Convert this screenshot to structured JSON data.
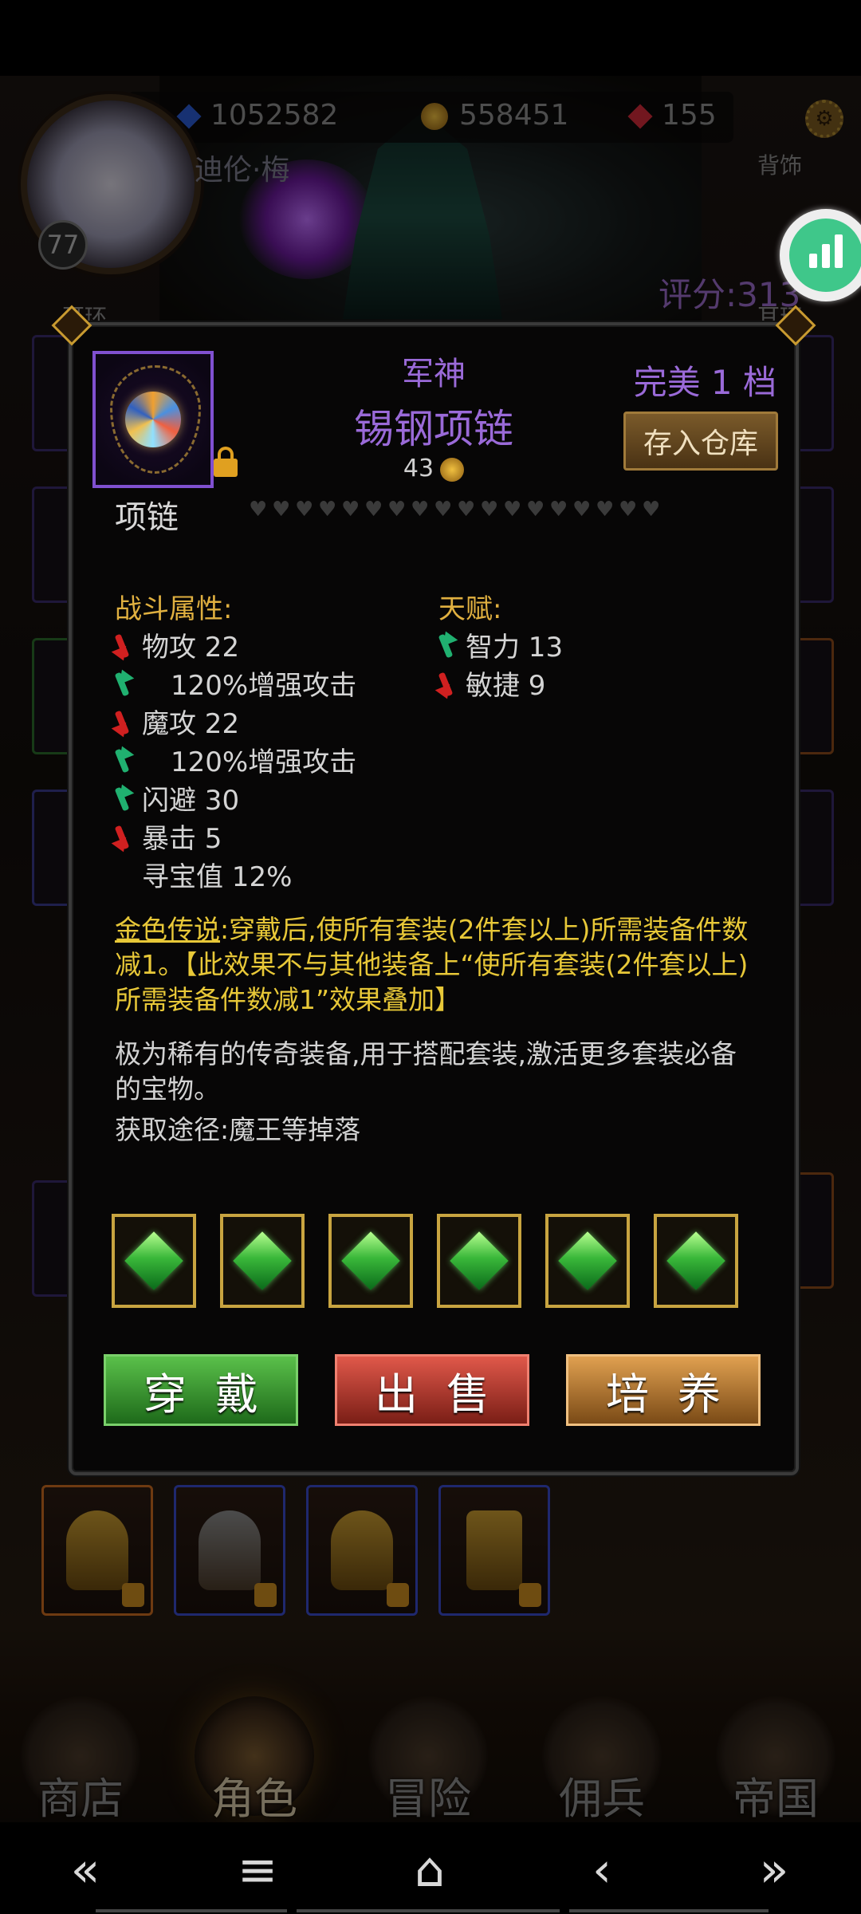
{
  "resources": {
    "gems": "1052582",
    "gold": "558451",
    "rubies": "155"
  },
  "player": {
    "name": "迪伦·梅",
    "level": "77"
  },
  "slot_labels": {
    "earring_left": "耳环",
    "back": "背饰",
    "earring_right": "耳环"
  },
  "score": "评分:313",
  "item": {
    "prefix": "军神",
    "name": "锡钢项链",
    "price": "43",
    "quality": "完美 1 档",
    "store_button": "存入仓库",
    "type": "项链",
    "durability_hearts": 18
  },
  "combat": {
    "title": "战斗属性:",
    "stats": [
      {
        "text": "物攻 22",
        "trend": "down"
      },
      {
        "text": "120%增强攻击",
        "trend": "up"
      },
      {
        "text": "魔攻 22",
        "trend": "down"
      },
      {
        "text": "120%增强攻击",
        "trend": "up"
      },
      {
        "text": "闪避 30",
        "trend": "up"
      },
      {
        "text": "暴击 5",
        "trend": "down"
      },
      {
        "text": "寻宝值 12%",
        "trend": "none"
      }
    ]
  },
  "talent": {
    "title": "天赋:",
    "stats": [
      {
        "text": "智力 13",
        "trend": "up"
      },
      {
        "text": "敏捷 9",
        "trend": "down"
      }
    ]
  },
  "legend": {
    "head": "金色传说",
    "body": ":穿戴后,使所有套装(2件套以上)所需装备件数减1。【此效果不与其他装备上“使所有套装(2件套以上)所需装备件数减1”效果叠加】"
  },
  "description": "极为稀有的传奇装备,用于搭配套装,激活更多套装必备的宝物。",
  "source": "获取途径:魔王等掉落",
  "socket_count": 6,
  "actions": {
    "wear": "穿戴",
    "sell": "出售",
    "train": "培养"
  },
  "bottom_nav": [
    {
      "label": "商店",
      "active": false
    },
    {
      "label": "角色",
      "active": true
    },
    {
      "label": "冒险",
      "active": false
    },
    {
      "label": "佣兵",
      "active": false
    },
    {
      "label": "帝国",
      "active": false
    }
  ],
  "system_nav": {
    "back_double": "«",
    "menu": "≡",
    "home": "⌂",
    "back": "‹",
    "forward_double": "»"
  },
  "colors": {
    "rarity_purple": "#9a6ad8",
    "legend_gold": "#e8c838",
    "up_green": "#20b070",
    "down_red": "#d02020"
  }
}
